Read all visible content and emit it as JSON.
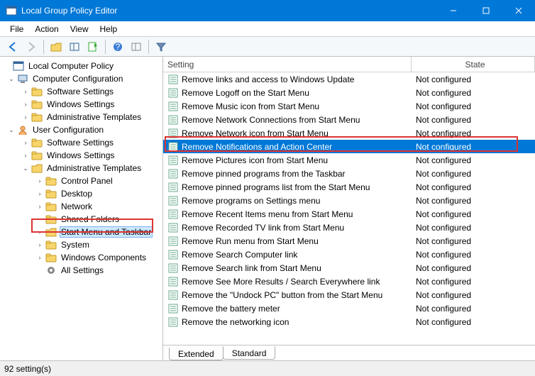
{
  "window": {
    "title": "Local Group Policy Editor"
  },
  "menu": {
    "file": "File",
    "action": "Action",
    "view": "View",
    "help": "Help"
  },
  "tree": {
    "root": "Local Computer Policy",
    "cc": "Computer Configuration",
    "uc": "User Configuration",
    "ss": "Software Settings",
    "ws": "Windows Settings",
    "at": "Administrative Templates",
    "cp": "Control Panel",
    "dk": "Desktop",
    "nw": "Network",
    "sf": "Shared Folders",
    "smt": "Start Menu and Taskbar",
    "sys": "System",
    "wc": "Windows Components",
    "as": "All Settings"
  },
  "columns": {
    "setting": "Setting",
    "state": "State"
  },
  "rows": [
    {
      "s": "Remove links and access to Windows Update",
      "st": "Not configured"
    },
    {
      "s": "Remove Logoff on the Start Menu",
      "st": "Not configured"
    },
    {
      "s": "Remove Music icon from Start Menu",
      "st": "Not configured"
    },
    {
      "s": "Remove Network Connections from Start Menu",
      "st": "Not configured"
    },
    {
      "s": "Remove Network icon from Start Menu",
      "st": "Not configured"
    },
    {
      "s": "Remove Notifications and Action Center",
      "st": "Not configured"
    },
    {
      "s": "Remove Pictures icon from Start Menu",
      "st": "Not configured"
    },
    {
      "s": "Remove pinned programs from the Taskbar",
      "st": "Not configured"
    },
    {
      "s": "Remove pinned programs list from the Start Menu",
      "st": "Not configured"
    },
    {
      "s": "Remove programs on Settings menu",
      "st": "Not configured"
    },
    {
      "s": "Remove Recent Items menu from Start Menu",
      "st": "Not configured"
    },
    {
      "s": "Remove Recorded TV link from Start Menu",
      "st": "Not configured"
    },
    {
      "s": "Remove Run menu from Start Menu",
      "st": "Not configured"
    },
    {
      "s": "Remove Search Computer link",
      "st": "Not configured"
    },
    {
      "s": "Remove Search link from Start Menu",
      "st": "Not configured"
    },
    {
      "s": "Remove See More Results / Search Everywhere link",
      "st": "Not configured"
    },
    {
      "s": "Remove the \"Undock PC\" button from the Start Menu",
      "st": "Not configured"
    },
    {
      "s": "Remove the battery meter",
      "st": "Not configured"
    },
    {
      "s": "Remove the networking icon",
      "st": "Not configured"
    }
  ],
  "tabs": {
    "extended": "Extended",
    "standard": "Standard"
  },
  "status": "92 setting(s)"
}
